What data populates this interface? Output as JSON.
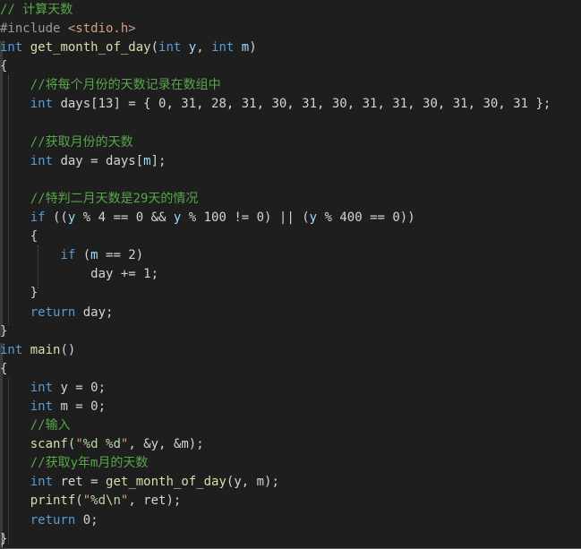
{
  "editor": {
    "lines": [
      [
        {
          "t": "// 计算天数",
          "c": "cm"
        }
      ],
      [
        {
          "t": "#include ",
          "c": "pp"
        },
        {
          "t": "<stdio.h>",
          "c": "st"
        }
      ],
      [
        {
          "t": "int",
          "c": "kw"
        },
        {
          "t": " "
        },
        {
          "t": "get_month_of_day",
          "c": "fn"
        },
        {
          "t": "("
        },
        {
          "t": "int",
          "c": "kw"
        },
        {
          "t": " "
        },
        {
          "t": "y",
          "c": "vr"
        },
        {
          "t": ", "
        },
        {
          "t": "int",
          "c": "kw"
        },
        {
          "t": " "
        },
        {
          "t": "m",
          "c": "vr"
        },
        {
          "t": ")"
        }
      ],
      [
        {
          "t": "{"
        }
      ],
      [
        {
          "t": "    "
        },
        {
          "t": "//将每个月份的天数记录在数组中",
          "c": "cm"
        }
      ],
      [
        {
          "t": "    "
        },
        {
          "t": "int",
          "c": "kw"
        },
        {
          "t": " days[13] = { 0, 31, 28, 31, 30, 31, 30, 31, 31, 30, 31, 30, 31 };"
        }
      ],
      [
        {
          "t": ""
        }
      ],
      [
        {
          "t": "    "
        },
        {
          "t": "//获取月份的天数",
          "c": "cm"
        }
      ],
      [
        {
          "t": "    "
        },
        {
          "t": "int",
          "c": "kw"
        },
        {
          "t": " day = days["
        },
        {
          "t": "m",
          "c": "vr"
        },
        {
          "t": "];"
        }
      ],
      [
        {
          "t": ""
        }
      ],
      [
        {
          "t": "    "
        },
        {
          "t": "//特判二月天数是29天的情况",
          "c": "cm"
        }
      ],
      [
        {
          "t": "    "
        },
        {
          "t": "if",
          "c": "kw"
        },
        {
          "t": " (("
        },
        {
          "t": "y",
          "c": "vr"
        },
        {
          "t": " % 4 == 0 && "
        },
        {
          "t": "y",
          "c": "vr"
        },
        {
          "t": " % 100 != 0) || ("
        },
        {
          "t": "y",
          "c": "vr"
        },
        {
          "t": " % 400 == 0))"
        }
      ],
      [
        {
          "t": "    {"
        }
      ],
      [
        {
          "t": "        "
        },
        {
          "t": "if",
          "c": "kw"
        },
        {
          "t": " ("
        },
        {
          "t": "m",
          "c": "vr"
        },
        {
          "t": " == 2)"
        }
      ],
      [
        {
          "t": "            day += 1;"
        }
      ],
      [
        {
          "t": "    }"
        }
      ],
      [
        {
          "t": "    "
        },
        {
          "t": "return",
          "c": "kw"
        },
        {
          "t": " day;"
        }
      ],
      [
        {
          "t": "}"
        }
      ],
      [
        {
          "t": "int",
          "c": "kw"
        },
        {
          "t": " "
        },
        {
          "t": "main",
          "c": "fn"
        },
        {
          "t": "()"
        }
      ],
      [
        {
          "t": "{"
        }
      ],
      [
        {
          "t": "    "
        },
        {
          "t": "int",
          "c": "kw"
        },
        {
          "t": " y = 0;"
        }
      ],
      [
        {
          "t": "    "
        },
        {
          "t": "int",
          "c": "kw"
        },
        {
          "t": " m = 0;"
        }
      ],
      [
        {
          "t": "    "
        },
        {
          "t": "//输入",
          "c": "cm"
        }
      ],
      [
        {
          "t": "    "
        },
        {
          "t": "scanf",
          "c": "fn"
        },
        {
          "t": "("
        },
        {
          "t": "\"",
          "c": "st"
        },
        {
          "t": "%d %d",
          "c": "esc"
        },
        {
          "t": "\"",
          "c": "st"
        },
        {
          "t": ", &y, &m);"
        }
      ],
      [
        {
          "t": "    "
        },
        {
          "t": "//获取y年m月的天数",
          "c": "cm"
        }
      ],
      [
        {
          "t": "    "
        },
        {
          "t": "int",
          "c": "kw"
        },
        {
          "t": " ret = "
        },
        {
          "t": "get_month_of_day",
          "c": "fn"
        },
        {
          "t": "(y, m);"
        }
      ],
      [
        {
          "t": "    "
        },
        {
          "t": "printf",
          "c": "fn"
        },
        {
          "t": "("
        },
        {
          "t": "\"",
          "c": "st"
        },
        {
          "t": "%d\\n",
          "c": "esc"
        },
        {
          "t": "\"",
          "c": "st"
        },
        {
          "t": ", ret);"
        }
      ],
      [
        {
          "t": "    "
        },
        {
          "t": "return",
          "c": "kw"
        },
        {
          "t": " 0;"
        }
      ],
      [
        {
          "t": "}"
        }
      ]
    ]
  }
}
